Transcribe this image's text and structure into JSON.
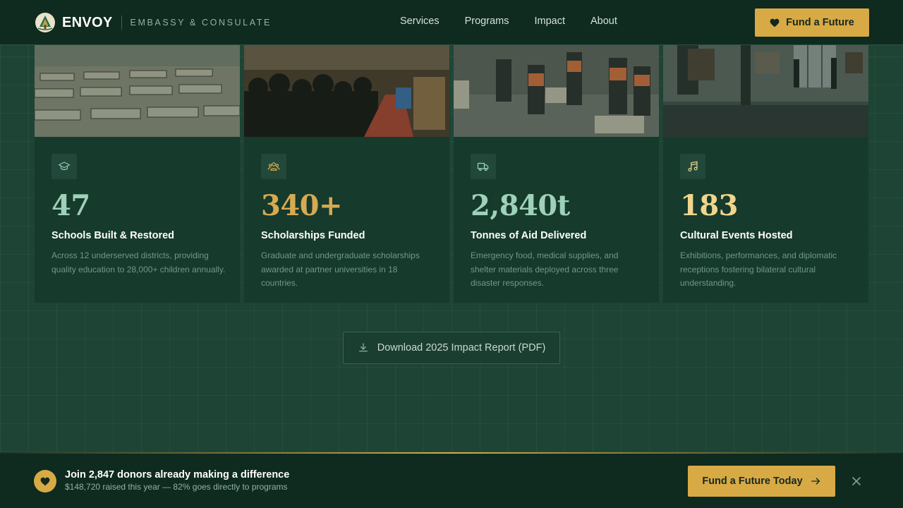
{
  "header": {
    "brand_name": "ENVOY",
    "brand_sub": "EMBASSY & CONSULATE",
    "nav": [
      "Services",
      "Programs",
      "Impact",
      "About"
    ],
    "cta_label": "Fund a Future"
  },
  "cards": [
    {
      "icon": "graduation-cap-icon",
      "stat": "47",
      "title": "Schools Built & Restored",
      "desc": "Across 12 underserved districts, providing quality education to 28,000+ children annually.",
      "photo": "classroom-photo"
    },
    {
      "icon": "people-group-icon",
      "stat": "340+",
      "title": "Scholarships Funded",
      "desc": "Graduate and undergraduate scholarships awarded at partner universities in 18 countries.",
      "photo": "graduation-ceremony-photo"
    },
    {
      "icon": "truck-icon",
      "stat": "2,840t",
      "title": "Tonnes of Aid Delivered",
      "desc": "Emergency food, medical supplies, and shelter materials deployed across three disaster responses.",
      "photo": "aid-workers-photo"
    },
    {
      "icon": "music-note-icon",
      "stat": "183",
      "title": "Cultural Events Hosted",
      "desc": "Exhibitions, performances, and diplomatic receptions fostering bilateral cultural understanding.",
      "photo": "gallery-hall-photo"
    }
  ],
  "download": {
    "label": "Download 2025 Impact Report (PDF)"
  },
  "donor_bar": {
    "title": "Join 2,847 donors already making a difference",
    "subtitle": "$148,720 raised this year — 82% goes directly to programs",
    "cta_label": "Fund a Future Today"
  },
  "colors": {
    "accent_gold": "#d8aa45",
    "background": "#1d4434",
    "card": "#163a2c",
    "header": "#0f2a1f"
  }
}
